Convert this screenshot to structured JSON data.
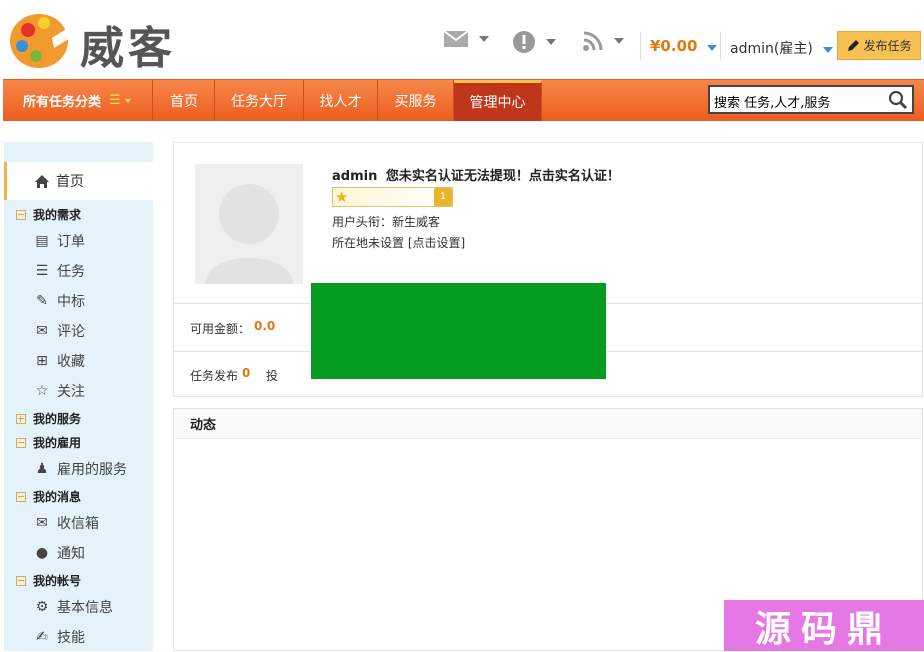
{
  "brand": {
    "name": "威客"
  },
  "topbar": {
    "money": "¥0.00",
    "user": "admin(雇主)",
    "publish": "发布任务"
  },
  "nav": {
    "categories": "所有任务分类",
    "items": [
      {
        "label": "首页"
      },
      {
        "label": "任务大厅"
      },
      {
        "label": "找人才"
      },
      {
        "label": "买服务"
      },
      {
        "label": "管理中心"
      }
    ]
  },
  "search": {
    "value": "搜索 任务,人才,服务"
  },
  "sidebar": {
    "home": "首页",
    "sections": [
      {
        "title": "我的需求",
        "items": [
          {
            "label": "订单",
            "icon": "order-icon"
          },
          {
            "label": "任务",
            "icon": "list-icon"
          },
          {
            "label": "中标",
            "icon": "edit-icon"
          },
          {
            "label": "评论",
            "icon": "comment-icon"
          },
          {
            "label": "收藏",
            "icon": "plus-box-icon"
          },
          {
            "label": "关注",
            "icon": "star-icon"
          }
        ]
      },
      {
        "title": "我的服务",
        "items": []
      },
      {
        "title": "我的雇用",
        "items": [
          {
            "label": "雇用的服务",
            "icon": "user-icon"
          }
        ]
      },
      {
        "title": "我的消息",
        "items": [
          {
            "label": "收信箱",
            "icon": "envelope-icon"
          },
          {
            "label": "通知",
            "icon": "alert-icon"
          }
        ]
      },
      {
        "title": "我的帐号",
        "items": [
          {
            "label": "基本信息",
            "icon": "gear-icon"
          },
          {
            "label": "技能",
            "icon": "wrench-icon"
          }
        ]
      }
    ]
  },
  "profile": {
    "username": "admin",
    "warning": "您未实名认证无法提现！点击实名认证！",
    "level": "1",
    "title_label": "用户头衔：新生威客",
    "location_label": "所在地未设置",
    "location_link": "[点击设置]"
  },
  "stats": {
    "balance_label": "可用金额：",
    "balance_value": "0.0",
    "published_label": "任务发布",
    "published_value": "0",
    "bid_label": "投"
  },
  "activity": {
    "title": "动态"
  },
  "watermark": {
    "text": "源码鼎"
  }
}
